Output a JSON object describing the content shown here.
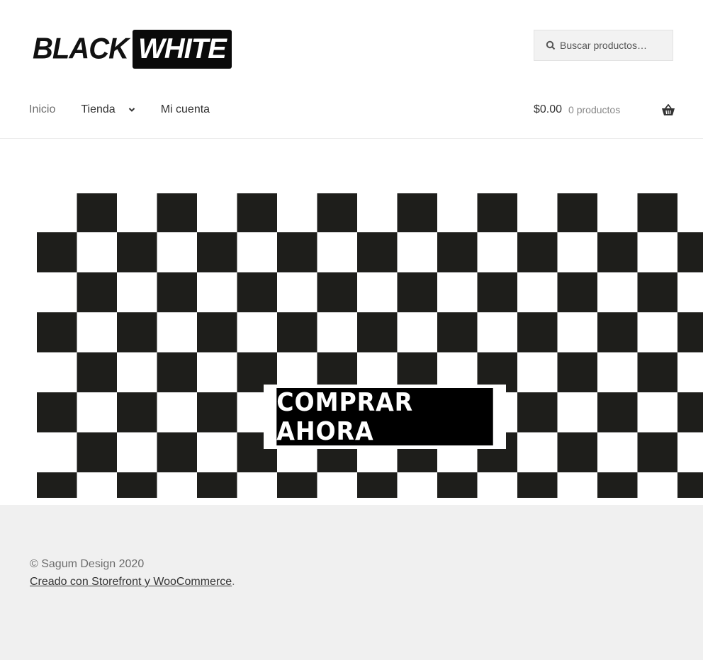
{
  "header": {
    "logo": {
      "word1": "BLACK",
      "word2": "WHITE"
    },
    "search": {
      "placeholder": "Buscar productos…"
    },
    "nav": {
      "items": [
        {
          "label": "Inicio",
          "active": true
        },
        {
          "label": "Tienda",
          "has_dropdown": true
        },
        {
          "label": "Mi cuenta"
        }
      ]
    },
    "cart": {
      "amount": "$0.00",
      "count_label": "0 productos",
      "icon": "basket-icon"
    }
  },
  "hero": {
    "pattern": "checkerboard",
    "colors": {
      "dark": "#1e1e1b",
      "light": "#ffffff"
    },
    "cta_label": "COMPRAR AHORA"
  },
  "footer": {
    "copyright": "© Sagum Design 2020",
    "credit_link": "Creado con Storefront y WooCommerce",
    "credit_suffix": "."
  }
}
